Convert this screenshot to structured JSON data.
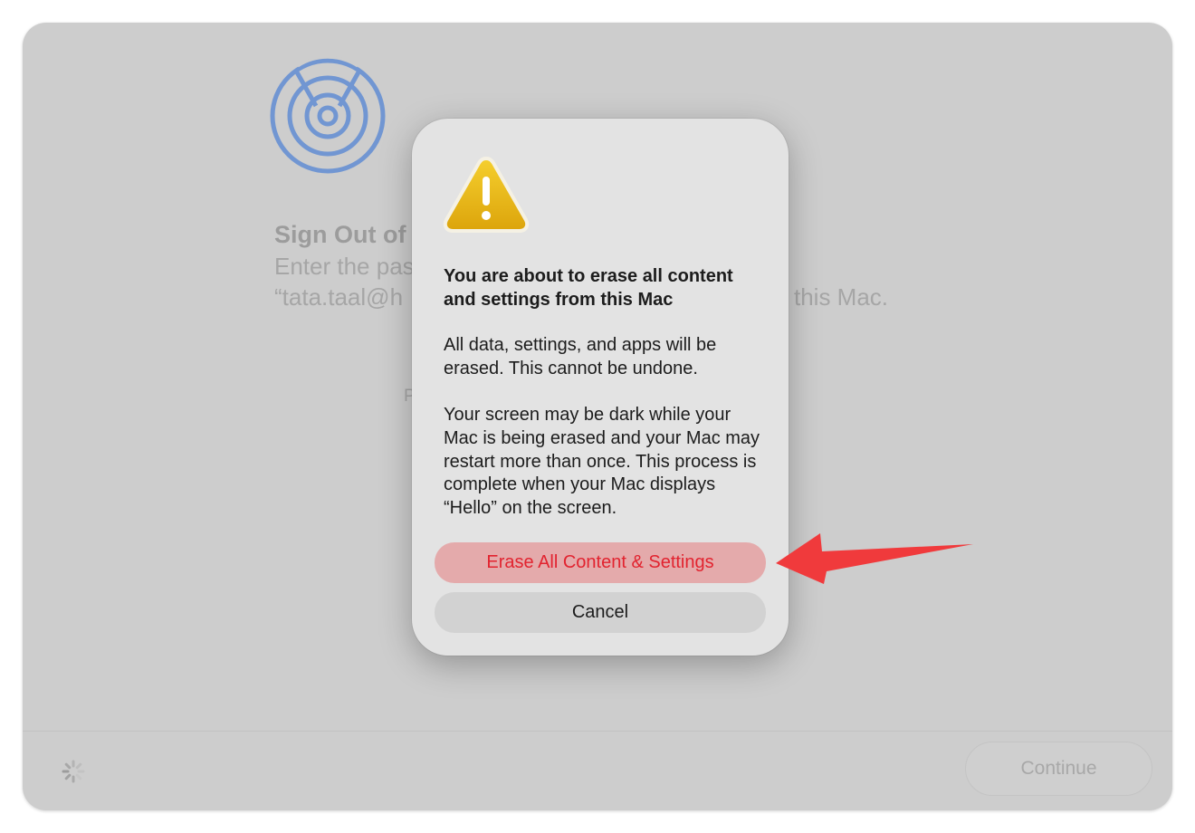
{
  "background": {
    "title": "Sign Out of",
    "line1": "Enter the pas",
    "line2": "“tata.taal@h",
    "line2_tail": "this Mac.",
    "field_label": "P",
    "icon": "find-my-icon"
  },
  "footer": {
    "continue_label": "Continue",
    "spinner_icon": "spinner-icon"
  },
  "dialog": {
    "icon": "warning-icon",
    "title": "You are about to erase all content and settings from this Mac",
    "paragraph1": "All data, settings, and apps will be erased. This cannot be undone.",
    "paragraph2": "Your screen may be dark while your Mac is being erased and your Mac may restart more than once. This process is complete when your Mac displays “Hello” on the screen.",
    "erase_label": "Erase All Content & Settings",
    "cancel_label": "Cancel"
  },
  "annotation": {
    "icon": "red-arrow-icon"
  },
  "colors": {
    "window_bg": "#cdcdcd",
    "dialog_bg": "#e3e3e3",
    "destructive_text": "#e2232f",
    "destructive_bg": "#e4aaab",
    "annotation_arrow": "#f03a3c",
    "icon_blue": "#6f93cf"
  }
}
